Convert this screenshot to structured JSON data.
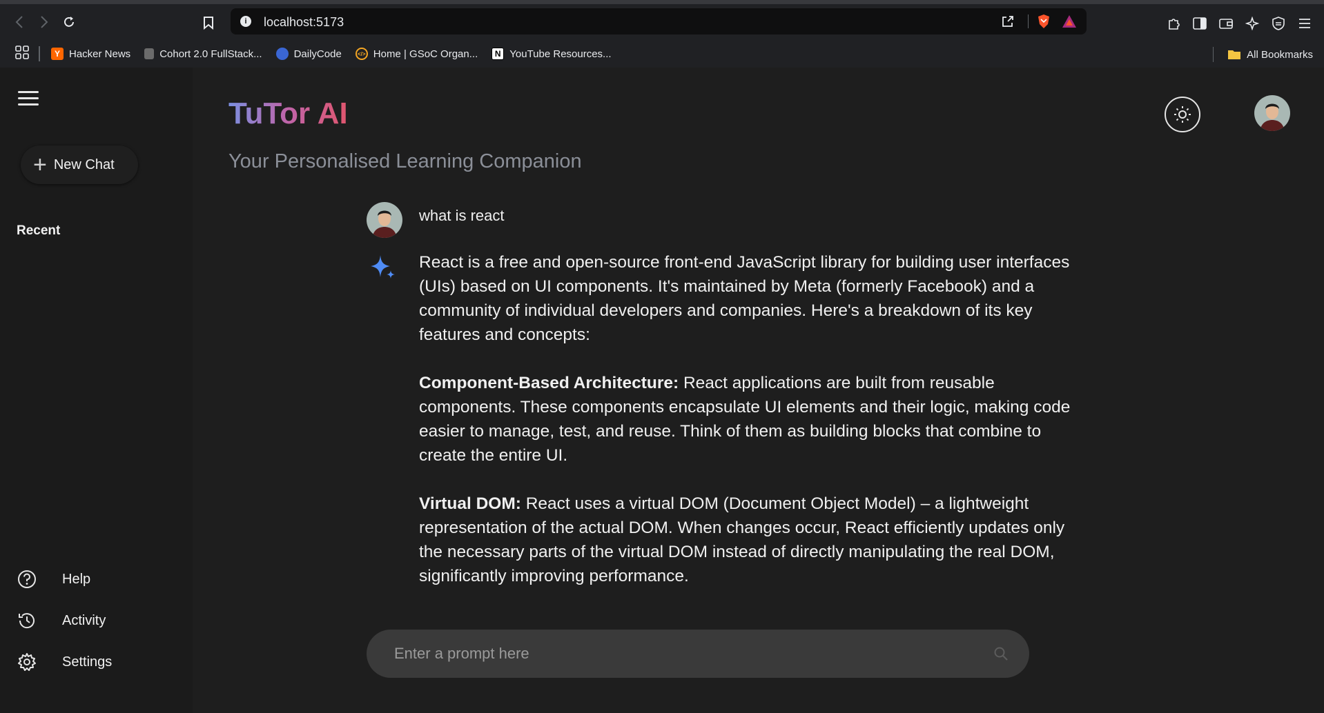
{
  "browser": {
    "url": "localhost:5173",
    "bookmarks": [
      {
        "label": "Hacker News",
        "icon": "hacker-news-icon",
        "color": "#ff6600",
        "glyph": "Y"
      },
      {
        "label": "Cohort 2.0 FullStack...",
        "icon": "document-icon",
        "color": "#888888",
        "glyph": ""
      },
      {
        "label": "DailyCode",
        "icon": "dailycode-icon",
        "color": "#3a66d4",
        "glyph": ""
      },
      {
        "label": "Home | GSoC Organ...",
        "icon": "gsoc-icon",
        "color": "#f5a623",
        "glyph": "</>"
      },
      {
        "label": "YouTube Resources...",
        "icon": "notion-icon",
        "color": "#ffffff",
        "glyph": "N"
      }
    ],
    "all_bookmarks": "All Bookmarks"
  },
  "sidebar": {
    "new_chat": "New Chat",
    "recent": "Recent",
    "items": [
      {
        "label": "Help",
        "icon": "help-icon"
      },
      {
        "label": "Activity",
        "icon": "history-icon"
      },
      {
        "label": "Settings",
        "icon": "gear-icon"
      }
    ]
  },
  "header": {
    "title": "TuTor AI",
    "subtitle": "Your Personalised Learning Companion"
  },
  "chat": {
    "user_message": "what is react",
    "answer": {
      "intro": "React is a free and open-source front-end JavaScript library for building user interfaces (UIs) based on UI components. It's maintained by Meta (formerly Facebook) and a community of individual developers and companies. Here's a breakdown of its key features and concepts:",
      "sections": [
        {
          "heading": "Component-Based Architecture:",
          "body": " React applications are built from reusable components. These components encapsulate UI elements and their logic, making code easier to manage, test, and reuse. Think of them as building blocks that combine to create the entire UI."
        },
        {
          "heading": "Virtual DOM:",
          "body": " React uses a virtual DOM (Document Object Model) – a lightweight representation of the actual DOM. When changes occur, React efficiently updates only the necessary parts of the virtual DOM instead of directly manipulating the real DOM, significantly improving performance."
        }
      ]
    }
  },
  "prompt": {
    "placeholder": "Enter a prompt here"
  },
  "colors": {
    "title_gradient": [
      "#7b8fe0",
      "#c064a8",
      "#e0566e"
    ],
    "gem": "#4f8cf5"
  }
}
